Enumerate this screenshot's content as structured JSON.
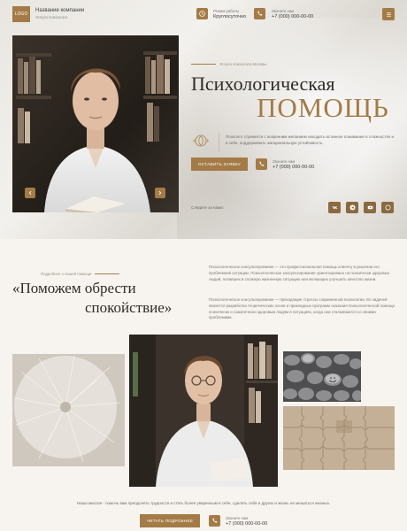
{
  "header": {
    "logo_text": "LOGO",
    "company_name": "Название компании",
    "company_sub": "Услуги психолога",
    "hours_label": "Режим работы",
    "hours_value": "Круглосуточно",
    "phone_label": "Звоните нам",
    "phone_value": "+7 (000) 000-00-00"
  },
  "hero": {
    "overline": "Услуги психолога Москвы",
    "title_line1": "Психологическая",
    "title_line2": "ПОМОЩЬ",
    "description": "Психолог стремится с искренним желанием находить истинное понимание в сложностях и в себе, поддерживать эмоциональную устойчивость.",
    "cta_label": "ОСТАВИТЬ ЗАЯВКУ",
    "phone_label": "Звоните нам",
    "phone_value": "+7 (000) 000-00-00",
    "follow_text": "Следите за нами:"
  },
  "about": {
    "overline": "Подробнее о нашей помощи",
    "quote_line1": "«Поможем обрести",
    "quote_line2": "спокойствие»",
    "paragraph1": "Психологическое консультирование — это профессиональная помощь клиенту в решении его проблемной ситуации. Психологическое консультирование ориентировано на психически здоровых людей, попавших в сложную жизненную ситуацию или желающих улучшить качество жизни.",
    "paragraph2": "Психологическое консультирование — преходящие стрессы современной психологии. Ее задачей является разработка теоретических основ и прикладных программ оказания психологической помощи психически и соматически здоровым людям в ситуациях, когда они сталкиваются со своими проблемами."
  },
  "footer_cta": {
    "text": "Наша миссия - помочь вам преодолеть трудности и стать более уверенным в себе, сделать себя и других и жизнь не мешаться жизнью.",
    "button_label": "ЧИТАТЬ ПОДРОБНЕЕ",
    "phone_label": "Звоните нам",
    "phone_value": "+7 (000) 000-00-00"
  },
  "colors": {
    "accent": "#a47b46",
    "background": "#f7f4f0",
    "text": "#3b3b3b"
  },
  "icons": [
    "clock-icon",
    "phone-icon",
    "menu-icon",
    "arrow-left-icon",
    "arrow-right-icon",
    "vk-icon",
    "telegram-icon",
    "youtube-icon",
    "whatsapp-icon"
  ]
}
